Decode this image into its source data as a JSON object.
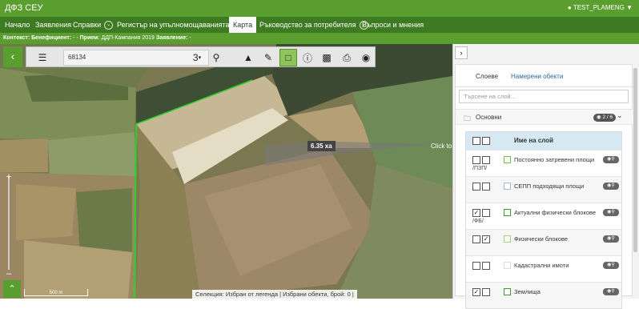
{
  "app": {
    "title": "ДФЗ СЕУ",
    "user": "TEST_PLAMENG"
  },
  "nav": [
    {
      "label": "Начало",
      "chevron": false,
      "active": false
    },
    {
      "label": "Заявления",
      "chevron": false,
      "active": false
    },
    {
      "label": "Справки",
      "chevron": true,
      "active": false
    },
    {
      "label": "Регистър на упълномощаванията",
      "chevron": true,
      "active": false
    },
    {
      "label": "Карта",
      "chevron": false,
      "active": true
    },
    {
      "label": "Ръководство за потребителя",
      "chevron": true,
      "active": false
    },
    {
      "label": "Въпроси и мнения",
      "chevron": false,
      "active": false
    }
  ],
  "context": {
    "label": "Контекст:",
    "beneficiary_label": "Бенефициент:",
    "beneficiary_value": "-",
    "intake_label": "Прием:",
    "intake_value": "ДДП-Кампания 2019",
    "application_label": "Заявление:",
    "application_value": "-"
  },
  "toolbar": {
    "search_value": "68134",
    "layer_count": "3"
  },
  "map": {
    "measurement": "6.35 ха",
    "click_hint": "Click to",
    "scale": "500 m",
    "status": "Селекция: Избран от легенда  |  Избрани обекти, брой: 0  |"
  },
  "sidebar": {
    "tabs": [
      {
        "label": "Слоеве",
        "active": true
      },
      {
        "label": "Намерени обекти",
        "active": false
      }
    ],
    "layer_search_placeholder": "Търсене на слой...",
    "group": {
      "label": "Основни",
      "badge": "2 / 6"
    },
    "table_header": "Име на слой",
    "layers": [
      {
        "name": "Постоянно затревени площи",
        "suffix": "/ПЗП/",
        "cb1": false,
        "cb2": false,
        "color": "#7ab84a"
      },
      {
        "name": "СЕПП подходящи площи",
        "suffix": "",
        "cb1": false,
        "cb2": false,
        "color": "#a8b4d8"
      },
      {
        "name": "Актуални физически блокове",
        "suffix": "/ФБ/",
        "cb1": true,
        "cb2": false,
        "color": "#3f9a2f"
      },
      {
        "name": "Физически блокове",
        "suffix": "",
        "cb1": false,
        "cb2": true,
        "color": "#a5d37c"
      },
      {
        "name": "Кадастрални имоти",
        "suffix": "",
        "cb1": false,
        "cb2": false,
        "color": "#dcdcdc"
      },
      {
        "name": "Землища",
        "suffix": "",
        "cb1": true,
        "cb2": false,
        "color": "#3f9a2f"
      }
    ]
  },
  "colors": {
    "brand": "#5a9e2f",
    "nav": "#3e7a22",
    "accent": "#8fc45a"
  }
}
